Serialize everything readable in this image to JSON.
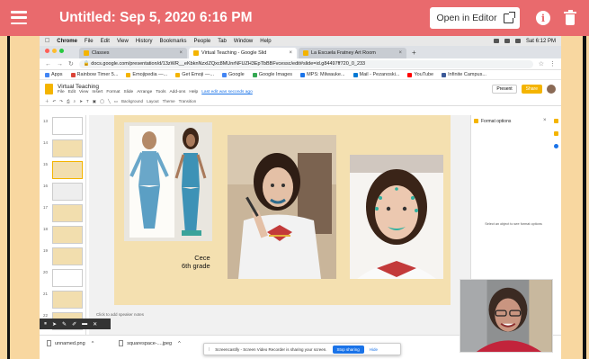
{
  "header": {
    "title": "Untitled: Sep 5, 2020 6:16 PM",
    "open_editor_label": "Open in Editor",
    "info_glyph": "i",
    "bg_color": "#e96a6d"
  },
  "mac_menubar": {
    "apple": "",
    "app": "Chrome",
    "menus": [
      "File",
      "Edit",
      "View",
      "History",
      "Bookmarks",
      "People",
      "Tab",
      "Window",
      "Help"
    ],
    "clock": "Sat 6:12 PM"
  },
  "browser": {
    "tabs": [
      {
        "label": "Classes",
        "color": "#f4b400",
        "active": false
      },
      {
        "label": "Virtual Teaching - Google Slid",
        "color": "#f4b400",
        "active": true
      },
      {
        "label": "La Escuela Fratney Art Room",
        "color": "#f4b400",
        "active": false
      }
    ],
    "new_tab": "+",
    "url": "docs.google.com/presentation/d/13zWR__eKbknNzxIZQxc8MUnrNFUZH3EpTbBBFvcessc/edit#slide=id.g84497ff720_0_233",
    "bookmarks": [
      {
        "label": "Apps",
        "color": "#4285f4"
      },
      {
        "label": "Rainbow Timer 5...",
        "color": "#db4437"
      },
      {
        "label": "Emojipedia —...",
        "color": "#f4b400"
      },
      {
        "label": "Get Emoji —...",
        "color": "#f4b400"
      },
      {
        "label": "Google",
        "color": "#4285f4"
      },
      {
        "label": "Google Images",
        "color": "#34a853"
      },
      {
        "label": "MPS: Milwauke...",
        "color": "#1a73e8"
      },
      {
        "label": "Mail - Pezanoski...",
        "color": "#0078d4"
      },
      {
        "label": "YouTube",
        "color": "#ff0000"
      },
      {
        "label": "Infinite Campus...",
        "color": "#3b5998"
      }
    ]
  },
  "slides": {
    "doc_title": "Virtual Teaching",
    "menus": [
      "File",
      "Edit",
      "View",
      "Insert",
      "Format",
      "Slide",
      "Arrange",
      "Tools",
      "Add-ons",
      "Help",
      "Last edit was seconds ago"
    ],
    "present_label": "Present",
    "share_label": "Share",
    "toolbar_items": [
      "Background",
      "Layout",
      "Theme",
      "Transition"
    ],
    "thumb_numbers": [
      "13",
      "14",
      "15",
      "16",
      "17",
      "18",
      "19",
      "20",
      "21",
      "22"
    ],
    "caption_line1": "Cece",
    "caption_line2": "6th grade",
    "speaker_notes": "Click to add speaker notes",
    "format_options": "Format options",
    "format_hint": "Select an object to see format options"
  },
  "downloads": [
    {
      "label": "unnamed.png"
    },
    {
      "label": "squarespace-....jpeg"
    }
  ],
  "share_bar": {
    "message": "Screencastify - Screen Video Recorder is sharing your screen.",
    "stop_label": "Stop sharing",
    "hide_label": "Hide"
  }
}
